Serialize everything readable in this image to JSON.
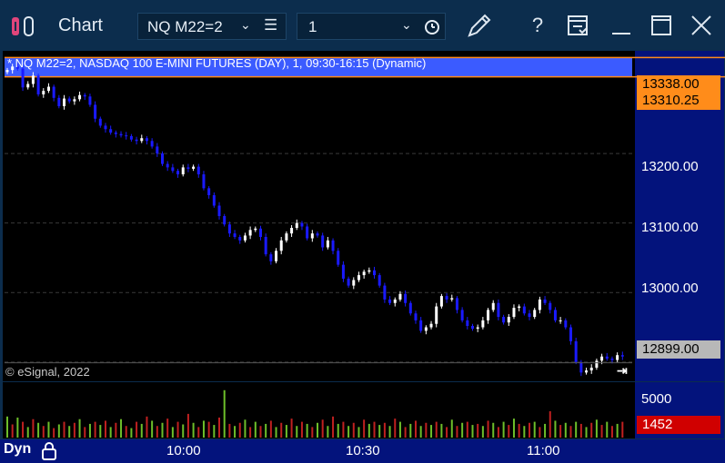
{
  "window": {
    "title": "Chart",
    "symbol": "NQ M22=2",
    "interval": "1",
    "buttons": [
      "edit-icon",
      "help-icon",
      "template-icon",
      "minimize-icon",
      "maximize-icon",
      "close-icon"
    ]
  },
  "chart": {
    "header": "* NQ M22=2, NASDAQ 100 E-MINI FUTURES (DAY), 1, 09:30-16:15 (Dynamic)",
    "copyright": "© eSignal, 2022",
    "footer_mode": "Dyn",
    "colors": {
      "background": "#000000",
      "axis": "#03137c",
      "up": "#ffffff",
      "down": "#1a1aff",
      "band": "#3b5bff",
      "band_border": "#ff8c1a",
      "last": "#b8b8b8",
      "vol_tag": "#d00000"
    }
  },
  "chart_data": {
    "type": "candlestick",
    "title": "* NQ M22=2, NASDAQ 100 E-MINI FUTURES (DAY), 1, 09:30-16:15 (Dynamic)",
    "x_tick_labels": [
      "10:00",
      "10:30",
      "11:00"
    ],
    "y_tick_labels": [
      "13200.00",
      "13100.00",
      "13000.00"
    ],
    "ylim": [
      12875,
      13345
    ],
    "band": {
      "high": "13338.00",
      "low": "13310.25"
    },
    "last_price": "12899.00",
    "volume_axis_label": "5000",
    "last_volume": "1452",
    "close_series": [
      13320,
      13325,
      13322,
      13295,
      13300,
      13312,
      13285,
      13290,
      13296,
      13280,
      13268,
      13279,
      13275,
      13278,
      13284,
      13282,
      13270,
      13250,
      13240,
      13235,
      13230,
      13228,
      13226,
      13225,
      13220,
      13218,
      13222,
      13218,
      13210,
      13200,
      13185,
      13180,
      13175,
      13170,
      13180,
      13178,
      13181,
      13170,
      13150,
      13140,
      13125,
      13110,
      13098,
      13085,
      13080,
      13075,
      13082,
      13090,
      13092,
      13080,
      13055,
      13045,
      13060,
      13075,
      13085,
      13093,
      13100,
      13095,
      13078,
      13085,
      13082,
      13065,
      13075,
      13060,
      13040,
      13020,
      13010,
      13018,
      13025,
      13030,
      13032,
      13025,
      13010,
      12990,
      12985,
      12990,
      12998,
      12985,
      12970,
      12960,
      12945,
      12950,
      12955,
      12980,
      12995,
      12990,
      12992,
      12975,
      12960,
      12952,
      12948,
      12950,
      12960,
      12975,
      12985,
      12965,
      12957,
      12965,
      12978,
      12980,
      12970,
      12965,
      12975,
      12990,
      12985,
      12975,
      12960,
      12960,
      12950,
      12930,
      12900,
      12885,
      12888,
      12892,
      12902,
      12908,
      12905,
      12903,
      12910,
      12908
    ],
    "volume_series": [
      40,
      25,
      38,
      30,
      20,
      35,
      28,
      22,
      30,
      18,
      25,
      30,
      22,
      28,
      35,
      20,
      26,
      30,
      24,
      32,
      20,
      28,
      35,
      22,
      18,
      30,
      26,
      40,
      32,
      22,
      28,
      36,
      20,
      30,
      25,
      45,
      28,
      20,
      32,
      30,
      24,
      38,
      90,
      26,
      22,
      28,
      34,
      20,
      30,
      22,
      26,
      32,
      20,
      28,
      24,
      36,
      22,
      30,
      26,
      20,
      28,
      34,
      22,
      40,
      26,
      30,
      22,
      28,
      20,
      34,
      26,
      30,
      24,
      28,
      22,
      36,
      30,
      20,
      26,
      32,
      22,
      28,
      24,
      30,
      26,
      20,
      34,
      22,
      28,
      30,
      24,
      26,
      22,
      32,
      28,
      20,
      30,
      24,
      36,
      26,
      22,
      28,
      30,
      20,
      26,
      50,
      32,
      24,
      28,
      22,
      30,
      26,
      20,
      28,
      34,
      24,
      30,
      22,
      26,
      30
    ]
  }
}
